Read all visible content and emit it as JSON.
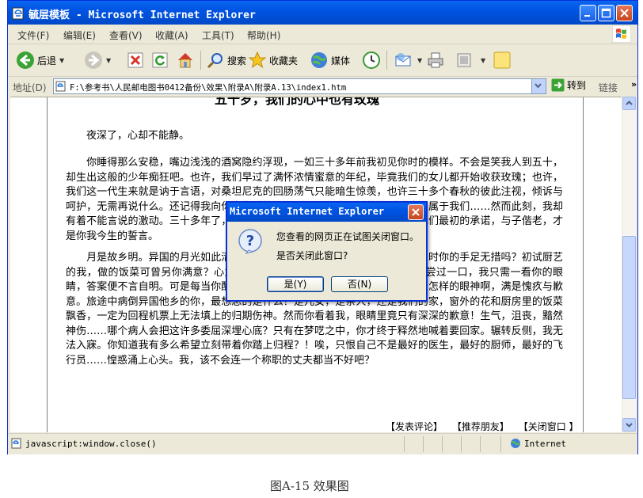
{
  "window": {
    "title": "毓层模板 - Microsoft Internet Explorer"
  },
  "menubar": {
    "items": [
      "文件(F)",
      "编辑(E)",
      "查看(V)",
      "收藏(A)",
      "工具(T)",
      "帮助(H)"
    ]
  },
  "toolbar": {
    "back_label": "后退",
    "search_label": "搜索",
    "favorites_label": "收藏夹",
    "media_label": "媒体"
  },
  "addressbar": {
    "label": "地址(D)",
    "url": "F:\\参考书\\人民邮电图书0412备份\\效果\\附录A\\附录A.13\\index1.htm",
    "go_label": "转到",
    "links_label": "链接"
  },
  "page": {
    "heading": "五十岁，我们的心中也有玫瑰",
    "para1": "夜深了，心却不能静。",
    "para2": "你睡得那么安稳，嘴边浅浅的酒窝隐约浮现，一如三十多年前我初见你时的模样。不会是笑我人到五十，却生出这般的少年痴狂吧。也许，我们早过了满怀浓情蜜意的年纪，毕竟我们的女儿都开始收获玫瑰；也许，我们这一代生来就是讷于言语，对桑坦尼克的回肠荡气只能暗生惊羡，也许三十多个春秋的彼此注视，倾诉与呵护，无需再说什么。还记得我向你表白时的紧张吗？……我那时的惊浮骇浪不属于我们……然而此刻，我却有着不能言说的激动。三十多年了，我们相濡以沫，执子之手，与子偕老，是我们最初的承诺，与子偕老，才是你我今生的誓言。",
    "para3": "月是故乡明。异国的月光如此清冷，远不及你眼中的温柔。还记得初到这里时你的手足无措吗？初试厨艺的我，做的饭菜可曾另你满意？心急火燎的我，总想给你一个惊喜，可每当你尝过一口，我只需一看你的眼睛，答案便不言自明。可是每当你醒来，我都还记得那是一种怎样的眼神，那是怎样的眼神啊，满是愧疚与歉意。旅途中病倒异国他乡的你，最想念的是什么？是儿女，是亲人，还是我们的家，窗外的花和厨房里的饭菜飘香，一定为回程机票上无法填上的归期伤神。然而你看着我，眼睛里竟只有深深的歉意！生气，沮丧，黯然神伤……哪个病人会把这许多委屈深埋心底？只有在梦呓之中，你才终于释然地喊着要回家。辗转反侧，我无法入寐。你知道我有多么希望立刻带着你踏上归程？！唉，只恨自己不是最好的医生，最好的厨师，最好的飞行员……惶惑涌上心头。我，该不会连一个称职的丈夫都当不好吧？",
    "footer_links": [
      "【发表评论】",
      "【推荐朋友】",
      "【关闭窗口 】"
    ]
  },
  "statusbar": {
    "text": "javascript:window.close()",
    "zone": "Internet"
  },
  "dialog": {
    "title": "Microsoft Internet Explorer",
    "message1": "您查看的网页正在试图关闭窗口。",
    "message2": "是否关闭此窗口?",
    "yes_label": "是(Y)",
    "no_label": "否(N)"
  },
  "caption": "图A-15  效果图"
}
